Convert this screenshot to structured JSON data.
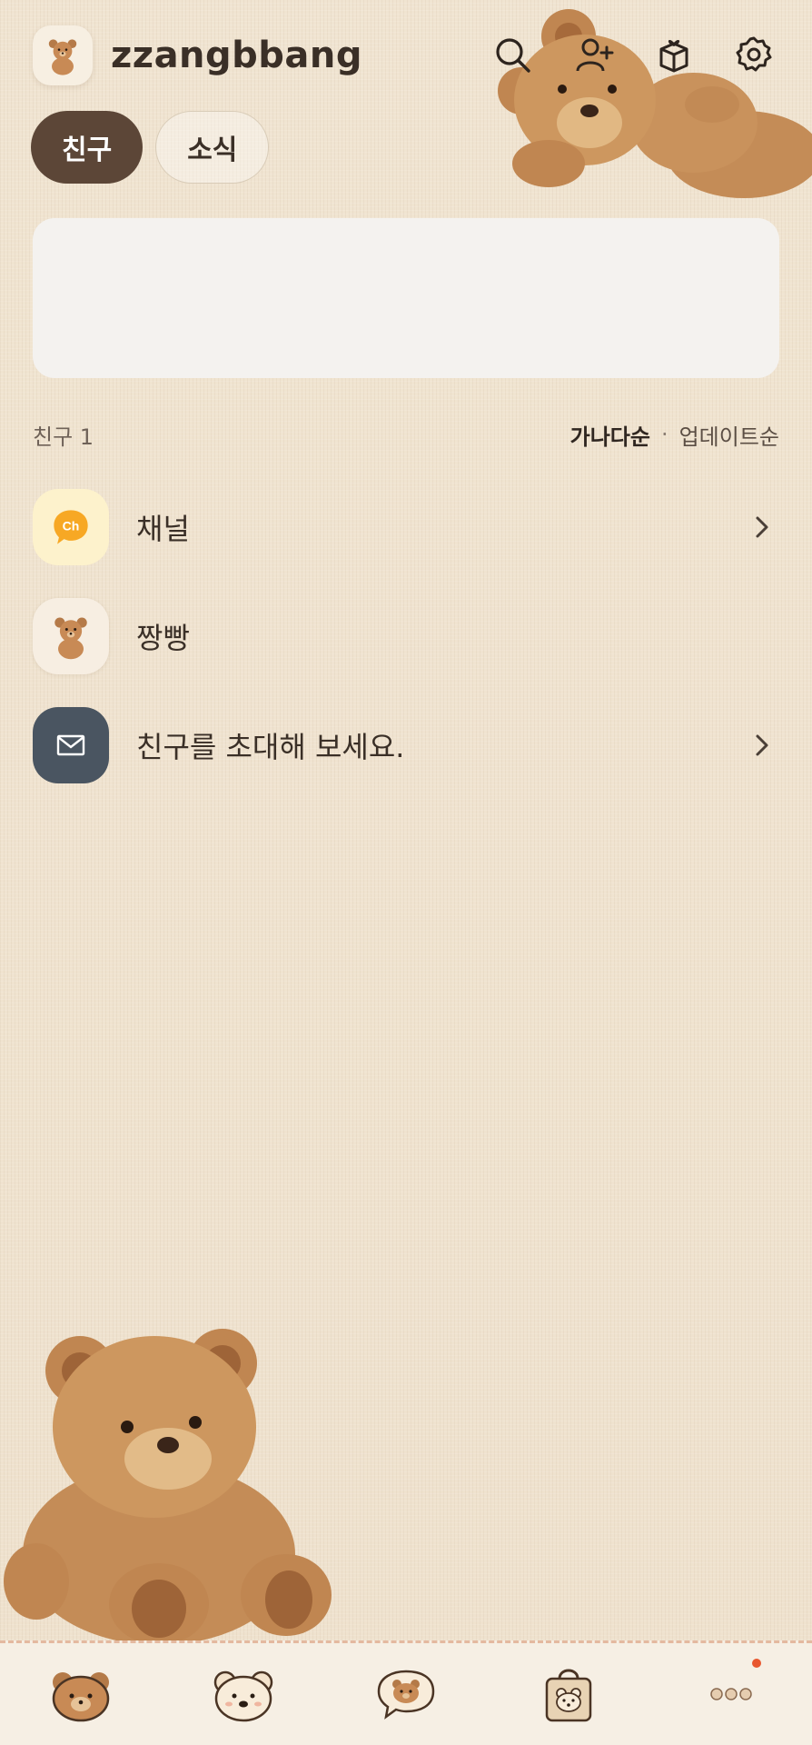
{
  "profile": {
    "name": "zzangbbang",
    "avatar_icon": "teddy-bear"
  },
  "header_icons": [
    "search-icon",
    "add-friend-icon",
    "gift-shop-icon",
    "settings-icon"
  ],
  "tabs": [
    {
      "label": "친구",
      "active": true
    },
    {
      "label": "소식",
      "active": false
    }
  ],
  "friends": {
    "count_label": "친구 1",
    "sort": {
      "active": "가나다순",
      "separator": "·",
      "other": "업데이트순"
    },
    "rows": [
      {
        "label": "채널",
        "icon": "channel-ch-icon",
        "badge_text": "Ch",
        "has_chevron": true
      },
      {
        "label": "짱빵",
        "icon": "teddy-bear",
        "has_chevron": false
      },
      {
        "label": "친구를 초대해 보세요.",
        "icon": "envelope-icon",
        "has_chevron": true
      }
    ]
  },
  "bottom_nav": [
    {
      "name": "friends",
      "icon": "bear-face-icon",
      "selected": true
    },
    {
      "name": "chats",
      "icon": "bear-face-white-icon",
      "selected": false
    },
    {
      "name": "openchat",
      "icon": "speech-bubble-bear-icon",
      "selected": false
    },
    {
      "name": "shopping",
      "icon": "shopping-bag-bear-icon",
      "selected": false
    },
    {
      "name": "more",
      "icon": "more-dots-icon",
      "selected": false
    }
  ],
  "colors": {
    "background": "#efe3cf",
    "active_tab": "#5c4637",
    "invite_avatar": "#4a5561",
    "channel_avatar": "#fdf2cc",
    "notification_dot": "#e8562e"
  }
}
